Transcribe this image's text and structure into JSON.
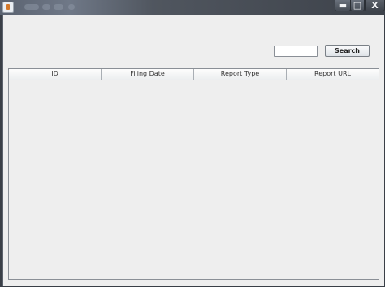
{
  "window": {
    "controls": {
      "minimize": "▬",
      "maximize": "□",
      "close": "X"
    }
  },
  "search": {
    "input_value": "",
    "button_label": "Search"
  },
  "table": {
    "columns": [
      "ID",
      "Filing Date",
      "Report Type",
      "Report URL"
    ],
    "rows": []
  }
}
